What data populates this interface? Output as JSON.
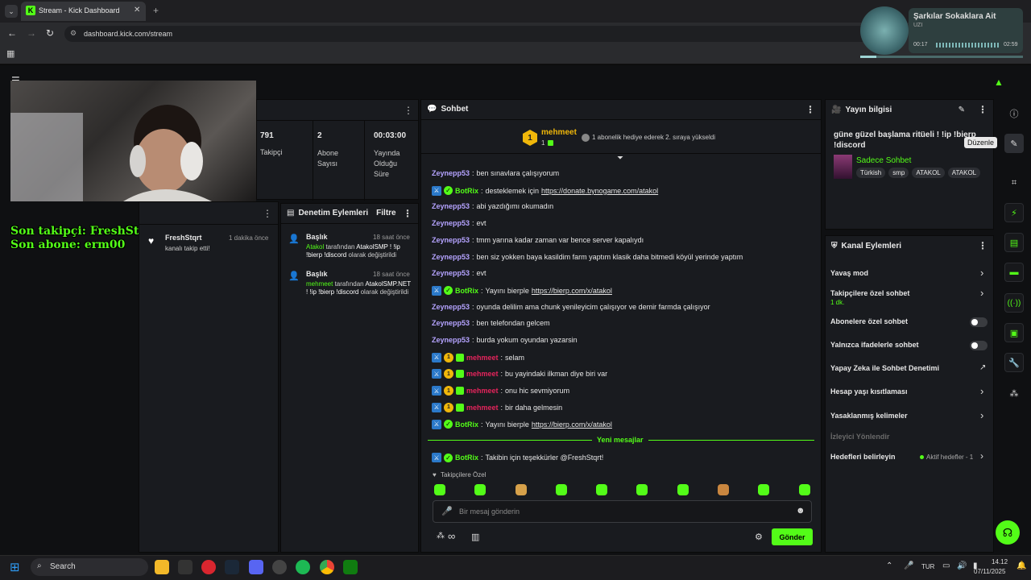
{
  "browser": {
    "tab_title": "Stream - Kick Dashboard",
    "url": "dashboard.kick.com/stream",
    "kick_logo": "K"
  },
  "stats": [
    {
      "value": "791",
      "label": "Takipçi"
    },
    {
      "value": "2",
      "label": "Abone Sayısı"
    },
    {
      "value": "00:03:00",
      "label": "Yayında Olduğu Süre"
    }
  ],
  "overlay": {
    "last_follower": "Son takipçi: FreshStqrt",
    "last_sub": "Son abone: erm00"
  },
  "activity": {
    "user": "FreshStqrt",
    "time": "1 dakika önce",
    "text": "kanalı takip etti!"
  },
  "moderation": {
    "title": "Denetim Eylemleri",
    "filter": "Filtre",
    "items": [
      {
        "title": "Başlık",
        "time": "18 saat önce",
        "actor": "Atakol",
        "text1": " tarafından ",
        "value": "AtakolSMP ! !ip !bierp !discord",
        "text2": " olarak değiştirildi"
      },
      {
        "title": "Başlık",
        "time": "18 saat önce",
        "actor": "mehmeet",
        "text1": " tarafından ",
        "value": "AtakolSMP.NET ! !ip !bierp !discord",
        "text2": " olarak değiştirildi"
      }
    ]
  },
  "chat": {
    "title": "Sohbet",
    "pinned_user": "mehmeet",
    "pinned_count": "1",
    "pinned_text": "1 abonelik hediye ederek 2. sıraya yükseldi",
    "messages": [
      {
        "user": "Zeynepp53",
        "type": "z",
        "text": "ben sınavlara çalışıyorum"
      },
      {
        "user": "BotRix",
        "type": "bot",
        "text": "desteklemek için ",
        "link": "https://donate.bynogame.com/atakol"
      },
      {
        "user": "Zeynepp53",
        "type": "z",
        "text": "abi yazdığımı okumadın"
      },
      {
        "user": "Zeynepp53",
        "type": "z",
        "text": "evt"
      },
      {
        "user": "Zeynepp53",
        "type": "z",
        "text": "tmm yarına kadar zaman var bence server kapalıydı"
      },
      {
        "user": "Zeynepp53",
        "type": "z",
        "text": "ben siz yokken baya kasildim farm yaptım klasik daha bitmedi köyül yerinde yaptım"
      },
      {
        "user": "Zeynepp53",
        "type": "z",
        "text": "evt"
      },
      {
        "user": "BotRix",
        "type": "bot",
        "text": "Yayını bierple ",
        "link": "https://bierp.com/x/atakol"
      },
      {
        "user": "Zeynepp53",
        "type": "z",
        "text": "oyunda delilim ama chunk yenileyicim çalışıyor ve demir farmda çalışıyor"
      },
      {
        "user": "Zeynepp53",
        "type": "z",
        "text": "ben telefondan gelcem"
      },
      {
        "user": "Zeynepp53",
        "type": "z",
        "text": "burda yokum oyundan yazarsin"
      },
      {
        "user": "mehmeet",
        "type": "m",
        "text": "selam"
      },
      {
        "user": "mehmeet",
        "type": "m",
        "text": "bu yayindaki ilkman diye biri var"
      },
      {
        "user": "mehmeet",
        "type": "m",
        "text": "onu hic sevmiyorum"
      },
      {
        "user": "mehmeet",
        "type": "m",
        "text": "bir daha gelmesin"
      },
      {
        "user": "BotRix",
        "type": "bot",
        "text": "Yayını bierple ",
        "link": "https://bierp.com/x/atakol"
      }
    ],
    "new_messages_label": "Yeni mesajlar",
    "last_message": {
      "user": "BotRix",
      "text": "Takibin için teşekkürler @FreshStqrt!"
    },
    "followers_only": "Takipçilere Özel",
    "input_placeholder": "Bir mesaj gönderin",
    "infinity": "∞",
    "send": "Gönder"
  },
  "stream_info": {
    "title": "Yayın bilgisi",
    "stream_title": "güne güzel başlama ritüeli ! !ip !bierp !discord",
    "category": "Sadece Sohbet",
    "tags": [
      "Türkish",
      "smp",
      "ATAKOL",
      "ATAKOL"
    ],
    "tooltip": "Düzenle"
  },
  "channel_actions": {
    "title": "Kanal Eylemleri",
    "items": [
      {
        "label": "Yavaş mod",
        "control": "chevron"
      },
      {
        "label": "Takipçilere özel sohbet",
        "sub": "1 dk.",
        "control": "chevron"
      },
      {
        "label": "Abonelere özel sohbet",
        "control": "toggle"
      },
      {
        "label": "Yalnızca ifadelerle sohbet",
        "control": "toggle"
      },
      {
        "label": "Yapay Zeka ile Sohbet Denetimi",
        "control": "external"
      },
      {
        "label": "Hesap yaşı kısıtlaması",
        "control": "chevron"
      },
      {
        "label": "Yasaklanmış kelimeler",
        "control": "chevron"
      }
    ],
    "viewer_redirect": "İzleyici Yönlendir",
    "goals_label": "Hedefleri belirleyin",
    "goals_status": "Aktif hedefler - 1"
  },
  "music": {
    "title": "Şarkılar Sokaklara Ait",
    "artist": "UZI",
    "elapsed": "00:17",
    "total": "02:59",
    "progress": 0.1
  },
  "taskbar": {
    "search": "Search",
    "lang": "TUR",
    "time": "14.12",
    "date": "07/11/2025"
  },
  "colors": {
    "accent": "#53fc18",
    "panel": "#191b1f"
  }
}
